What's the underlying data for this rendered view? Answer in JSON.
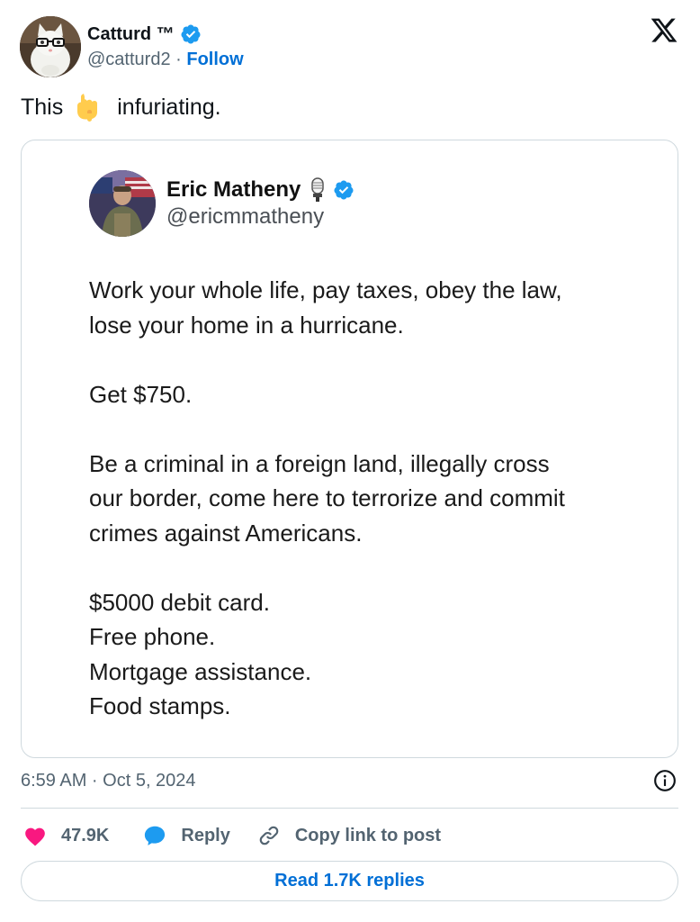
{
  "author": {
    "name": "Catturd ™",
    "handle": "@catturd2",
    "separator": "·",
    "follow_label": "Follow"
  },
  "tweet": {
    "text_before": "This",
    "emoji": "pointing-down-emoji",
    "text_after": "infuriating."
  },
  "embedded_post": {
    "name": "Eric Matheny",
    "handle": "@ericmmatheny",
    "paragraphs": [
      [
        "Work your whole life, pay taxes, obey the law,",
        "lose your home in a hurricane."
      ],
      [
        "Get $750."
      ],
      [
        "Be a criminal in a foreign land, illegally cross",
        "our border, come here to terrorize and commit",
        "crimes against Americans."
      ],
      [
        "$5000 debit card.",
        "Free phone.",
        "Mortgage assistance.",
        "Food stamps."
      ]
    ]
  },
  "meta": {
    "timestamp": "6:59 AM · Oct 5, 2024"
  },
  "actions": {
    "like_count": "47.9K",
    "reply_label": "Reply",
    "copy_label": "Copy link to post"
  },
  "read_replies_label": "Read 1.7K replies",
  "colors": {
    "link_blue": "#006fd6",
    "verified_blue": "#1d9bf0",
    "like_pink": "#f91880",
    "muted_gray": "#536471",
    "border": "#cfd9de"
  },
  "icons": [
    "verified-badge-icon",
    "x-logo-icon",
    "microphone-icon",
    "info-icon",
    "heart-icon",
    "reply-bubble-icon",
    "link-icon"
  ]
}
